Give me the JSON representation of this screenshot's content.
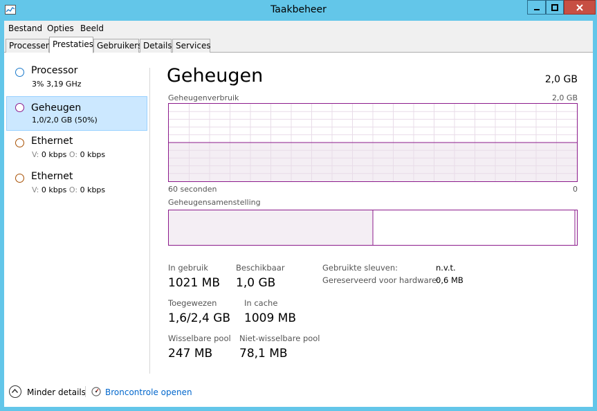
{
  "window": {
    "title": "Taakbeheer"
  },
  "menu": [
    "Bestand",
    "Opties",
    "Beeld"
  ],
  "tabs": [
    "Processen",
    "Prestaties",
    "Gebruikers",
    "Details",
    "Services"
  ],
  "active_tab": "Prestaties",
  "sidebar": [
    {
      "name": "Processor",
      "sub_value": "3%  3,19 GHz",
      "color": "#1979ca"
    },
    {
      "name": "Geheugen",
      "sub_value": "1,0/2,0 GB (50%)",
      "color": "#8b1a8b"
    },
    {
      "name": "Ethernet",
      "sub_v_label": "V:",
      "sub_v_value": "0 kbps",
      "sub_o_label": "O:",
      "sub_o_value": "0 kbps",
      "color": "#a74f01"
    },
    {
      "name": "Ethernet",
      "sub_v_label": "V:",
      "sub_v_value": "0 kbps",
      "sub_o_label": "O:",
      "sub_o_value": "0 kbps",
      "color": "#a74f01"
    }
  ],
  "main": {
    "title": "Geheugen",
    "total": "2,0 GB",
    "graph_label": "Geheugenverbruik",
    "graph_max": "2,0 GB",
    "graph_time_left": "60 seconden",
    "graph_time_right": "0",
    "graph_usage_fraction": 0.5,
    "composition_label": "Geheugensamenstelling",
    "composition_used_fraction": 0.5,
    "composition_standby_fraction": 0.0,
    "stats": {
      "in_use_label": "In gebruik",
      "in_use_value": "1021 MB",
      "available_label": "Beschikbaar",
      "available_value": "1,0 GB",
      "committed_label": "Toegewezen",
      "committed_value": "1,6/2,4 GB",
      "cached_label": "In cache",
      "cached_value": "1009 MB",
      "paged_label": "Wisselbare pool",
      "paged_value": "247 MB",
      "nonpaged_label": "Niet-wisselbare pool",
      "nonpaged_value": "78,1 MB"
    },
    "details": {
      "slots_label": "Gebruikte sleuven:",
      "slots_value": "n.v.t.",
      "reserved_label": "Gereserveerd voor hardware:",
      "reserved_value": "0,6 MB"
    }
  },
  "footer": {
    "fewer_details": "Minder details",
    "resource_monitor": "Broncontrole openen"
  },
  "colors": {
    "memory": "#8b1a8b",
    "titlebar": "#63c6e9",
    "selected": "#cce8ff",
    "link": "#0066cc"
  }
}
